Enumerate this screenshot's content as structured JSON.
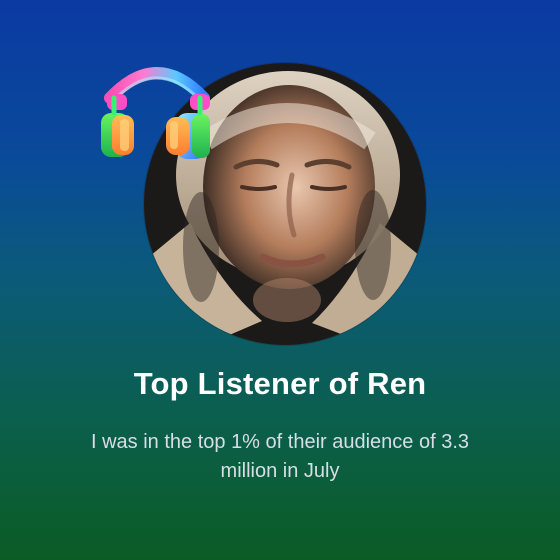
{
  "card": {
    "title": "Top Listener of Ren",
    "subtitle": "I was in the top 1% of their audience of 3.3 million in July"
  },
  "icons": {
    "avatar": "artist-avatar",
    "headphones": "headphones-icon"
  },
  "colors": {
    "background_top": "#0b3aa3",
    "background_bottom": "#0b5c24",
    "text_primary": "#ffffff",
    "text_secondary": "#d8dde7"
  }
}
